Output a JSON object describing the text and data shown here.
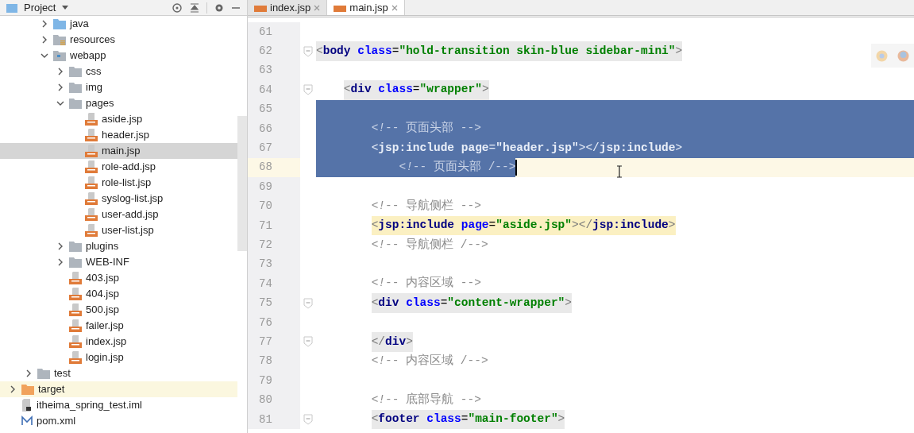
{
  "project_panel": {
    "title": "Project",
    "tree": [
      {
        "children": [
          {
            "children": [
              {
                "label": "java",
                "kind": "folder-source",
                "expanded": false,
                "selected": false,
                "highlighted": false
              },
              {
                "label": "resources",
                "kind": "folder-resources",
                "expanded": false,
                "selected": false,
                "highlighted": false
              },
              {
                "label": "webapp",
                "kind": "folder-web",
                "expanded": true,
                "selected": false,
                "highlighted": false,
                "children": [
                  {
                    "label": "css",
                    "kind": "folder",
                    "expanded": false,
                    "selected": false,
                    "highlighted": false
                  },
                  {
                    "label": "img",
                    "kind": "folder",
                    "expanded": false,
                    "selected": false,
                    "highlighted": false
                  },
                  {
                    "label": "pages",
                    "kind": "folder",
                    "expanded": true,
                    "selected": false,
                    "highlighted": false,
                    "children": [
                      {
                        "label": "aside.jsp",
                        "kind": "jsp",
                        "selected": false,
                        "highlighted": false
                      },
                      {
                        "label": "header.jsp",
                        "kind": "jsp",
                        "selected": false,
                        "highlighted": false
                      },
                      {
                        "label": "main.jsp",
                        "kind": "jsp",
                        "selected": true,
                        "highlighted": false
                      },
                      {
                        "label": "role-add.jsp",
                        "kind": "jsp",
                        "selected": false,
                        "highlighted": false
                      },
                      {
                        "label": "role-list.jsp",
                        "kind": "jsp",
                        "selected": false,
                        "highlighted": false
                      },
                      {
                        "label": "syslog-list.jsp",
                        "kind": "jsp",
                        "selected": false,
                        "highlighted": false
                      },
                      {
                        "label": "user-add.jsp",
                        "kind": "jsp",
                        "selected": false,
                        "highlighted": false
                      },
                      {
                        "label": "user-list.jsp",
                        "kind": "jsp",
                        "selected": false,
                        "highlighted": false
                      }
                    ]
                  },
                  {
                    "label": "plugins",
                    "kind": "folder",
                    "expanded": false,
                    "selected": false,
                    "highlighted": false
                  },
                  {
                    "label": "WEB-INF",
                    "kind": "folder",
                    "expanded": false,
                    "selected": false,
                    "highlighted": false
                  },
                  {
                    "label": "403.jsp",
                    "kind": "jsp",
                    "selected": false,
                    "highlighted": false
                  },
                  {
                    "label": "404.jsp",
                    "kind": "jsp",
                    "selected": false,
                    "highlighted": false
                  },
                  {
                    "label": "500.jsp",
                    "kind": "jsp",
                    "selected": false,
                    "highlighted": false
                  },
                  {
                    "label": "failer.jsp",
                    "kind": "jsp",
                    "selected": false,
                    "highlighted": false
                  },
                  {
                    "label": "index.jsp",
                    "kind": "jsp",
                    "selected": false,
                    "highlighted": false
                  },
                  {
                    "label": "login.jsp",
                    "kind": "jsp",
                    "selected": false,
                    "highlighted": false
                  }
                ]
              }
            ]
          },
          {
            "label": "test",
            "kind": "folder",
            "expanded": false,
            "selected": false,
            "highlighted": false
          }
        ]
      },
      {
        "label": "target",
        "kind": "folder-excluded",
        "expanded": false,
        "selected": false,
        "highlighted": true
      },
      {
        "label": "itheima_spring_test.iml",
        "kind": "iml",
        "selected": false,
        "highlighted": false
      },
      {
        "label": "pom.xml",
        "kind": "xml",
        "selected": false,
        "highlighted": false
      }
    ]
  },
  "editor": {
    "tabs": [
      {
        "label": "index.jsp",
        "selected": false
      },
      {
        "label": "main.jsp",
        "selected": true
      }
    ],
    "lines": [
      {
        "number": "61",
        "selected": false,
        "current": false,
        "fold": false
      },
      {
        "number": "62",
        "segments": [
          {
            "kind": "punct",
            "text": "<"
          },
          {
            "kind": "tag",
            "text": "body"
          },
          {
            "kind": "attr",
            "text": " class"
          },
          {
            "kind": "plain",
            "text": "="
          },
          {
            "kind": "str",
            "text": "\"hold-transition skin-blue sidebar-mini\""
          },
          {
            "kind": "punct",
            "text": ">"
          }
        ],
        "selected": false,
        "current": false,
        "tag_highlight": true,
        "match_highlight": false,
        "fold": true
      },
      {
        "number": "63",
        "selected": false,
        "current": false,
        "fold": false
      },
      {
        "number": "64",
        "segments": [
          {
            "kind": "punct",
            "text": "    <"
          },
          {
            "kind": "tag",
            "text": "div"
          },
          {
            "kind": "attr",
            "text": " class"
          },
          {
            "kind": "plain",
            "text": "="
          },
          {
            "kind": "str",
            "text": "\"wrapper\""
          },
          {
            "kind": "punct",
            "text": ">"
          }
        ],
        "selected": false,
        "current": false,
        "tag_highlight": true,
        "match_highlight": false,
        "fold": true
      },
      {
        "number": "65",
        "selected": true,
        "current": false,
        "fold": false
      },
      {
        "number": "66",
        "segments": [
          {
            "kind": "comment",
            "text": "        <*!*-- 页面头部 -->"
          }
        ],
        "selected": true,
        "current": false,
        "tag_highlight": false,
        "match_highlight": false,
        "fold": false
      },
      {
        "number": "67",
        "segments": [
          {
            "kind": "punct",
            "text": "        <"
          },
          {
            "kind": "tag",
            "text": "jsp:include"
          },
          {
            "kind": "attr",
            "text": " page"
          },
          {
            "kind": "plain",
            "text": "="
          },
          {
            "kind": "str",
            "text": "\"header.jsp\""
          },
          {
            "kind": "punct",
            "text": "></"
          },
          {
            "kind": "tag",
            "text": "jsp:include"
          },
          {
            "kind": "punct",
            "text": ">"
          }
        ],
        "selected": true,
        "current": false,
        "tag_highlight": false,
        "match_highlight": false,
        "fold": false
      },
      {
        "number": "68",
        "segments": [
          {
            "kind": "comment",
            "text": "            <*!*-- 页面头部 /-->"
          }
        ],
        "selected": true,
        "current": true,
        "tag_highlight": false,
        "match_highlight": false,
        "fold": false
      },
      {
        "number": "69",
        "selected": false,
        "current": false,
        "fold": false
      },
      {
        "number": "70",
        "segments": [
          {
            "kind": "comment",
            "text": "        <*!*-- 导航侧栏 -->"
          }
        ],
        "selected": false,
        "current": false,
        "tag_highlight": false,
        "match_highlight": false,
        "fold": false
      },
      {
        "number": "71",
        "segments": [
          {
            "kind": "punct",
            "text": "        <"
          },
          {
            "kind": "tag",
            "text": "jsp:include"
          },
          {
            "kind": "attr",
            "text": " page"
          },
          {
            "kind": "plain",
            "text": "="
          },
          {
            "kind": "str",
            "text": "\"aside.jsp\""
          },
          {
            "kind": "punct",
            "text": "></"
          },
          {
            "kind": "tag",
            "text": "jsp:include"
          },
          {
            "kind": "punct",
            "text": ">"
          }
        ],
        "selected": false,
        "current": false,
        "tag_highlight": false,
        "match_highlight": true,
        "fold": false
      },
      {
        "number": "72",
        "segments": [
          {
            "kind": "comment",
            "text": "        <*!*-- 导航侧栏 /-->"
          }
        ],
        "selected": false,
        "current": false,
        "tag_highlight": false,
        "match_highlight": false,
        "fold": false
      },
      {
        "number": "73",
        "selected": false,
        "current": false,
        "fold": false
      },
      {
        "number": "74",
        "segments": [
          {
            "kind": "comment",
            "text": "        <*!*-- 内容区域 -->"
          }
        ],
        "selected": false,
        "current": false,
        "tag_highlight": false,
        "match_highlight": false,
        "fold": false
      },
      {
        "number": "75",
        "segments": [
          {
            "kind": "punct",
            "text": "        <"
          },
          {
            "kind": "tag",
            "text": "div"
          },
          {
            "kind": "attr",
            "text": " class"
          },
          {
            "kind": "plain",
            "text": "="
          },
          {
            "kind": "str",
            "text": "\"content-wrapper\""
          },
          {
            "kind": "punct",
            "text": ">"
          }
        ],
        "selected": false,
        "current": false,
        "tag_highlight": true,
        "match_highlight": false,
        "fold": true
      },
      {
        "number": "76",
        "selected": false,
        "current": false,
        "fold": false
      },
      {
        "number": "77",
        "segments": [
          {
            "kind": "punct",
            "text": "        </"
          },
          {
            "kind": "tag",
            "text": "div"
          },
          {
            "kind": "punct",
            "text": ">"
          }
        ],
        "selected": false,
        "current": false,
        "tag_highlight": true,
        "match_highlight": false,
        "fold": true
      },
      {
        "number": "78",
        "segments": [
          {
            "kind": "comment",
            "text": "        <*!*-- 内容区域 /-->"
          }
        ],
        "selected": false,
        "current": false,
        "tag_highlight": false,
        "match_highlight": false,
        "fold": false
      },
      {
        "number": "79",
        "selected": false,
        "current": false,
        "fold": false
      },
      {
        "number": "80",
        "segments": [
          {
            "kind": "comment",
            "text": "        <*!*-- 底部导航 -->"
          }
        ],
        "selected": false,
        "current": false,
        "tag_highlight": false,
        "match_highlight": false,
        "fold": false
      },
      {
        "number": "81",
        "segments": [
          {
            "kind": "punct",
            "text": "        <"
          },
          {
            "kind": "tag",
            "text": "footer"
          },
          {
            "kind": "attr",
            "text": " class"
          },
          {
            "kind": "plain",
            "text": "="
          },
          {
            "kind": "str",
            "text": "\"main-footer\""
          },
          {
            "kind": "punct",
            "text": ">"
          }
        ],
        "selected": false,
        "current": false,
        "tag_highlight": true,
        "match_highlight": false,
        "fold": true
      }
    ]
  }
}
